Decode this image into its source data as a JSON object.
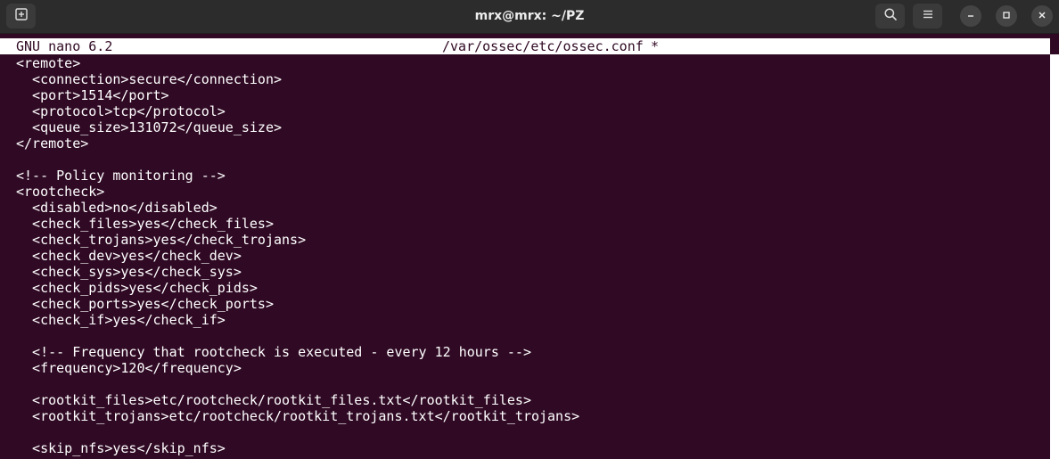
{
  "window": {
    "title": "mrx@mrx: ~/PZ",
    "icons": {
      "new_tab": "new-tab-icon",
      "search": "search-icon",
      "menu": "hamburger-menu-icon",
      "minimize": "minimize-icon",
      "maximize": "maximize-icon",
      "close": "close-icon"
    }
  },
  "nano": {
    "version": "GNU nano 6.2",
    "filename": "/var/ossec/etc/ossec.conf",
    "modified_marker": "*"
  },
  "editor": {
    "lines": [
      "<remote>",
      "  <connection>secure</connection>",
      "  <port>1514</port>",
      "  <protocol>tcp</protocol>",
      "  <queue_size>131072</queue_size>",
      "</remote>",
      "",
      "<!-- Policy monitoring -->",
      "<rootcheck>",
      "  <disabled>no</disabled>",
      "  <check_files>yes</check_files>",
      "  <check_trojans>yes</check_trojans>",
      "  <check_dev>yes</check_dev>",
      "  <check_sys>yes</check_sys>",
      "  <check_pids>yes</check_pids>",
      "  <check_ports>yes</check_ports>",
      "  <check_if>yes</check_if>",
      "",
      "  <!-- Frequency that rootcheck is executed - every 12 hours -->",
      "  <frequency>120</frequency>",
      "",
      "  <rootkit_files>etc/rootcheck/rootkit_files.txt</rootkit_files>",
      "  <rootkit_trojans>etc/rootcheck/rootkit_trojans.txt</rootkit_trojans>",
      "",
      "  <skip_nfs>yes</skip_nfs>"
    ]
  },
  "colors": {
    "terminal_bg": "#300a24",
    "titlebar_bg": "#2c2c2c",
    "text": "#ffffff"
  }
}
